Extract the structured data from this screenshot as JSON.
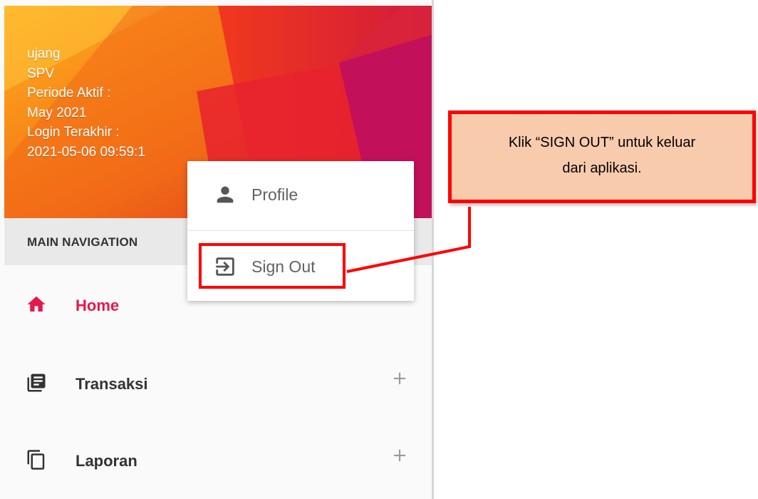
{
  "user_panel": {
    "username": "ujang",
    "role": "SPV",
    "period_label": "Periode Aktif :",
    "period_value": "May 2021",
    "last_login_label": "Login Terakhir :",
    "last_login_value": "2021-05-06 09:59:1"
  },
  "nav": {
    "header": "MAIN NAVIGATION",
    "items": [
      {
        "label": "Home",
        "icon": "home-icon",
        "active": true
      },
      {
        "label": "Transaksi",
        "icon": "book-icon",
        "expand": "+"
      },
      {
        "label": "Laporan",
        "icon": "copy-icon",
        "expand": "+"
      }
    ]
  },
  "dropdown": {
    "items": [
      {
        "label": "Profile",
        "icon": "person-icon"
      },
      {
        "label": "Sign Out",
        "icon": "sign-out-icon"
      }
    ]
  },
  "callout": {
    "text": "Klik “SIGN OUT” untuk keluar\ndari aplikasi."
  },
  "colors": {
    "accent": "#e6194a",
    "annotation": "#ff0000",
    "callout_fill": "#f8cbad"
  }
}
